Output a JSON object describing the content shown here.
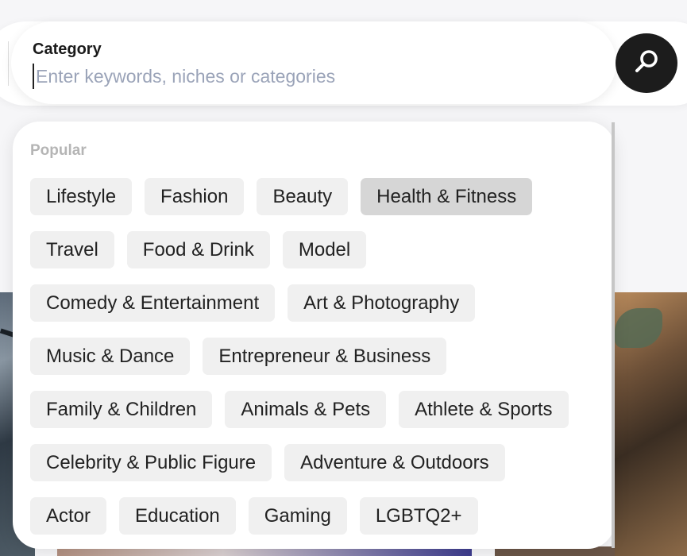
{
  "search": {
    "label": "Category",
    "placeholder": "Enter keywords, niches or categories",
    "button_icon": "search-icon"
  },
  "dropdown": {
    "section_title": "Popular",
    "rows": [
      [
        {
          "label": "Lifestyle"
        },
        {
          "label": "Fashion"
        },
        {
          "label": "Beauty"
        },
        {
          "label": "Health & Fitness",
          "active": true
        }
      ],
      [
        {
          "label": "Travel"
        },
        {
          "label": "Food & Drink"
        },
        {
          "label": "Model"
        }
      ],
      [
        {
          "label": "Comedy & Entertainment"
        },
        {
          "label": "Art & Photography"
        }
      ],
      [
        {
          "label": "Music & Dance"
        },
        {
          "label": "Entrepreneur & Business"
        }
      ],
      [
        {
          "label": "Family & Children"
        },
        {
          "label": "Animals & Pets"
        },
        {
          "label": "Athlete & Sports"
        }
      ],
      [
        {
          "label": "Celebrity & Public Figure"
        },
        {
          "label": "Adventure & Outdoors"
        }
      ],
      [
        {
          "label": "Actor"
        },
        {
          "label": "Education"
        },
        {
          "label": "Gaming"
        },
        {
          "label": "LGBTQ2+"
        }
      ]
    ]
  },
  "colors": {
    "search_button": "#1c1c1c",
    "chip_bg": "#f0f0f0",
    "chip_active_bg": "#d6d6d6",
    "placeholder": "#9aa3b8"
  }
}
